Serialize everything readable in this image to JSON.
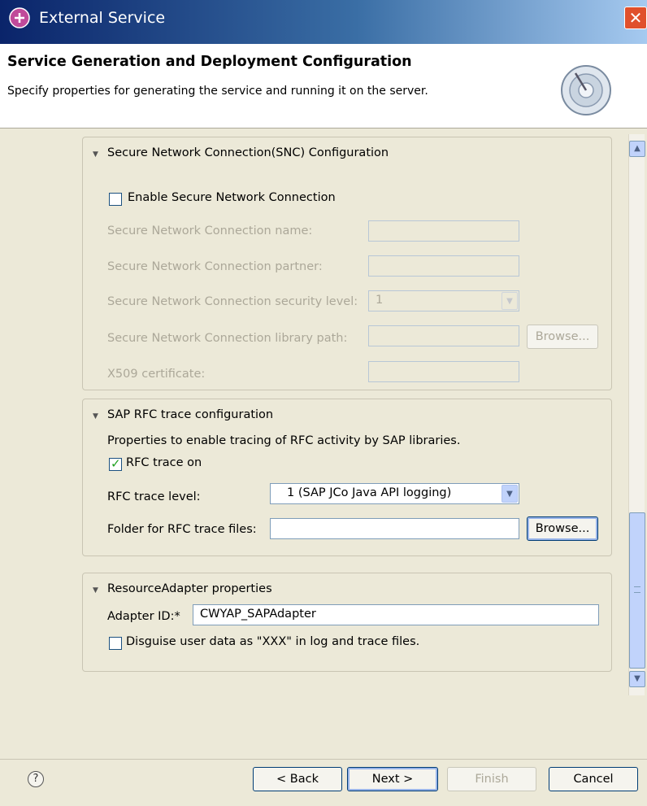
{
  "window": {
    "title": "External Service"
  },
  "header": {
    "title": "Service Generation and Deployment Configuration",
    "description": "Specify properties for generating the service and running it on the server."
  },
  "snc": {
    "heading": "Secure Network Connection(SNC) Configuration",
    "enable_label": "Enable Secure Network Connection",
    "enable_checked": false,
    "name_label": "Secure Network Connection name:",
    "name_value": "",
    "partner_label": "Secure Network Connection partner:",
    "partner_value": "",
    "level_label": "Secure Network Connection security level:",
    "level_value": "1",
    "library_label": "Secure Network Connection library path:",
    "library_value": "",
    "browse_label": "Browse...",
    "x509_label": "X509 certificate:",
    "x509_value": ""
  },
  "trace": {
    "heading": "SAP RFC trace configuration",
    "description": "Properties to enable tracing of RFC activity by SAP libraries.",
    "rfc_on_label": "RFC trace on",
    "rfc_on_checked": true,
    "level_label": "RFC trace level:",
    "level_value": "1 (SAP JCo Java API logging)",
    "folder_label": "Folder for RFC trace files:",
    "folder_value": "",
    "browse_label": "Browse..."
  },
  "ra": {
    "heading": "ResourceAdapter properties",
    "adapter_id_label": "Adapter ID:*",
    "adapter_id_value": "CWYAP_SAPAdapter",
    "disguise_label": "Disguise user data as \"XXX\" in log and trace files.",
    "disguise_checked": false
  },
  "footer": {
    "back_label": "< Back",
    "next_label": "Next >",
    "finish_label": "Finish",
    "cancel_label": "Cancel"
  },
  "colors": {
    "titlebar_start": "#0a246a",
    "titlebar_end": "#a6caf0",
    "close": "#e0502c",
    "background": "#ece9d8"
  },
  "icons": [
    "app-icon",
    "close-icon",
    "wizard-graphic-icon",
    "collapse-arrow-icon",
    "dropdown-arrow-icon",
    "help-icon",
    "scroll-up-icon",
    "scroll-down-icon"
  ]
}
